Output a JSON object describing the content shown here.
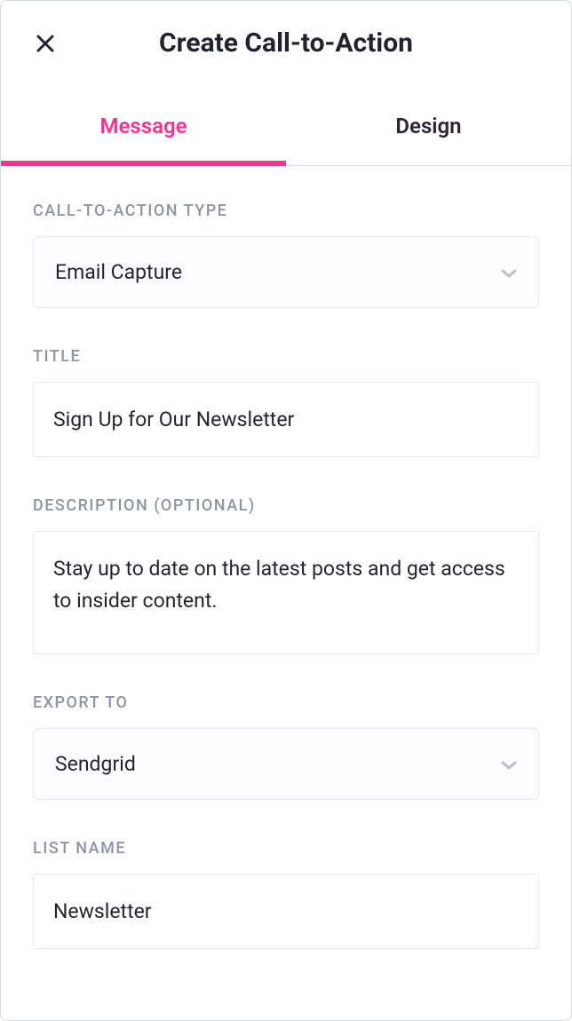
{
  "header": {
    "title": "Create Call-to-Action"
  },
  "tabs": {
    "message": "Message",
    "design": "Design"
  },
  "form": {
    "cta_type": {
      "label": "CALL-TO-ACTION TYPE",
      "value": "Email Capture"
    },
    "title": {
      "label": "TITLE",
      "value": "Sign Up for Our Newsletter"
    },
    "description": {
      "label": "DESCRIPTION (OPTIONAL)",
      "value": "Stay up to date on the latest posts and get access to insider content."
    },
    "export_to": {
      "label": "EXPORT TO",
      "value": "Sendgrid"
    },
    "list_name": {
      "label": "LIST NAME",
      "value": "Newsletter"
    }
  }
}
